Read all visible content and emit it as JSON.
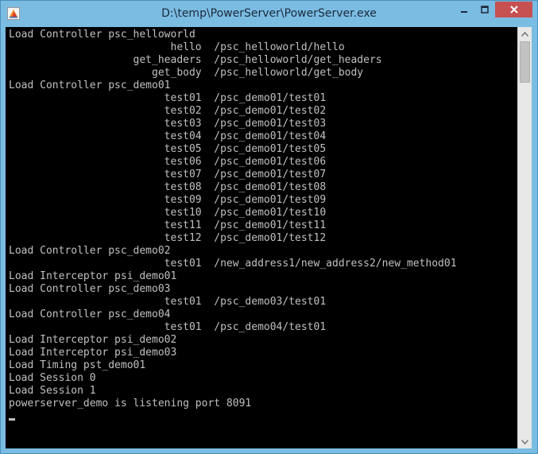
{
  "window": {
    "title": "D:\\temp\\PowerServer\\PowerServer.exe",
    "icon": "powerserver-app-icon",
    "controls": {
      "minimize": "minimize-icon",
      "maximize": "maximize-icon",
      "close": "close-icon"
    },
    "colors": {
      "frame": "#7bbce3",
      "close": "#c75050",
      "console_bg": "#000000",
      "console_fg": "#c0c0c0"
    }
  },
  "console": {
    "lines": [
      "Load Controller psc_helloworld",
      "                          hello  /psc_helloworld/hello",
      "                    get_headers  /psc_helloworld/get_headers",
      "                       get_body  /psc_helloworld/get_body",
      "Load Controller psc_demo01",
      "                         test01  /psc_demo01/test01",
      "                         test02  /psc_demo01/test02",
      "                         test03  /psc_demo01/test03",
      "                         test04  /psc_demo01/test04",
      "                         test05  /psc_demo01/test05",
      "                         test06  /psc_demo01/test06",
      "                         test07  /psc_demo01/test07",
      "                         test08  /psc_demo01/test08",
      "                         test09  /psc_demo01/test09",
      "                         test10  /psc_demo01/test10",
      "                         test11  /psc_demo01/test11",
      "                         test12  /psc_demo01/test12",
      "Load Controller psc_demo02",
      "                         test01  /new_address1/new_address2/new_method01",
      "Load Interceptor psi_demo01",
      "Load Controller psc_demo03",
      "                         test01  /psc_demo03/test01",
      "Load Controller psc_demo04",
      "                         test01  /psc_demo04/test01",
      "Load Interceptor psi_demo02",
      "Load Interceptor psi_demo03",
      "Load Timing pst_demo01",
      "Load Session 0",
      "Load Session 1",
      "powerserver_demo is listening port 8091"
    ]
  },
  "scrollbar": {
    "up": "scroll-up-arrow-icon",
    "down": "scroll-down-arrow-icon"
  }
}
